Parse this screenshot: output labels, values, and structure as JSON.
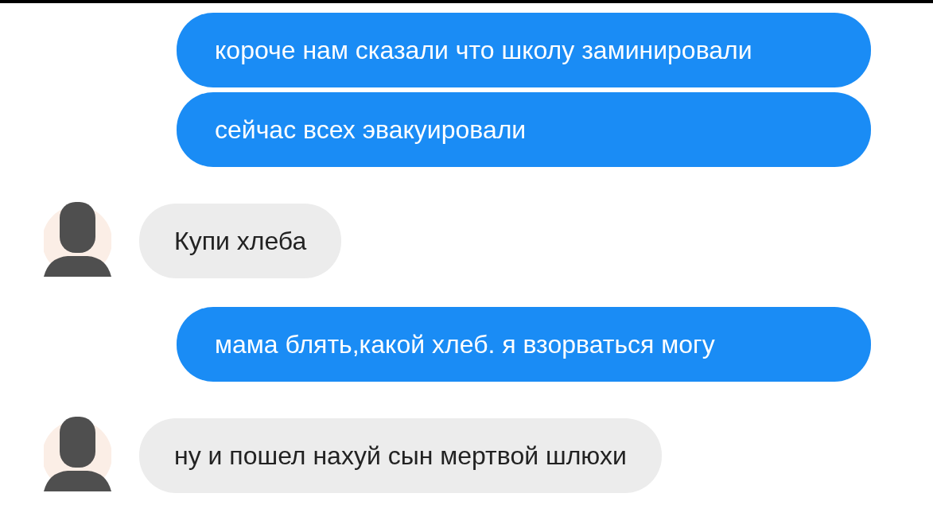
{
  "messages": [
    {
      "kind": "sent",
      "text": "короче нам сказали что школу заминировали"
    },
    {
      "kind": "sent",
      "text": "сейчас всех эвакуировали"
    },
    {
      "kind": "received",
      "text": "Купи хлеба"
    },
    {
      "kind": "sent",
      "text": "мама блять,какой хлеб. я взорваться могу"
    },
    {
      "kind": "received",
      "text": "ну и пошел нахуй сын мертвой шлюхи"
    }
  ]
}
